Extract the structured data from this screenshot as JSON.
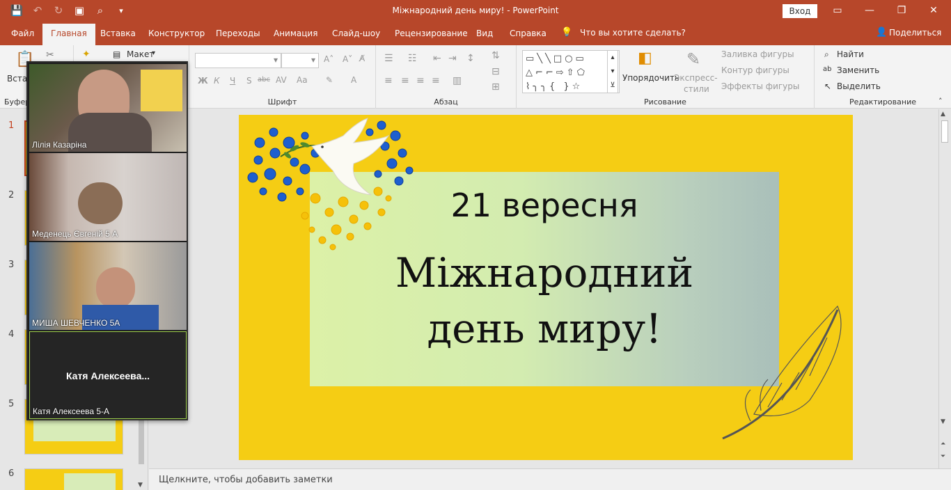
{
  "window": {
    "title": "Міжнародний день миру!  -  PowerPoint",
    "signin": "Вход"
  },
  "quick_access": [
    "save-icon",
    "undo-icon",
    "redo-icon",
    "present-icon",
    "print-preview-icon",
    "customize-icon"
  ],
  "menu": {
    "tabs": [
      "Файл",
      "Главная",
      "Вставка",
      "Конструктор",
      "Переходы",
      "Анимация",
      "Слайд-шоу",
      "Рецензирование",
      "Вид",
      "Справка"
    ],
    "active": "Главная",
    "tell_me": "Что вы хотите сделать?",
    "share": "Поделиться"
  },
  "ribbon": {
    "clipboard": {
      "paste": "Вста",
      "label": "Буфер"
    },
    "slides": {
      "layout": "Макет"
    },
    "font": {
      "label": "Шрифт",
      "bold": "Ж",
      "italic": "К",
      "underline": "Ч",
      "strike": "S",
      "strike2": "abc",
      "case": "Aa",
      "color": "A"
    },
    "paragraph": {
      "label": "Абзац"
    },
    "drawing": {
      "label": "Рисование",
      "arrange": "Упорядочить",
      "quick_styles_1": "Экспресс-",
      "quick_styles_2": "стили",
      "fill": "Заливка фигуры",
      "outline": "Контур фигуры",
      "effects": "Эффекты фигуры"
    },
    "editing": {
      "label": "Редактирование",
      "find": "Найти",
      "replace": "Заменить",
      "select": "Выделить"
    }
  },
  "thumbnails": [
    {
      "num": "1",
      "current": true
    },
    {
      "num": "2",
      "current": false
    },
    {
      "num": "3",
      "current": false
    },
    {
      "num": "4",
      "current": false
    },
    {
      "num": "5",
      "current": false
    },
    {
      "num": "6",
      "current": false
    }
  ],
  "slide": {
    "date": "21 вересня",
    "title_line1": "Міжнародний",
    "title_line2": "день миру!"
  },
  "notes_placeholder": "Щелкните, чтобы добавить заметки",
  "video_call": {
    "participants": [
      {
        "name": "Лілія Казаріна",
        "video": true
      },
      {
        "name": "Меденець Євгеній 5 А",
        "video": true
      },
      {
        "name": "МИША ШЕВЧЕНКО 5А",
        "video": true
      },
      {
        "name": "Катя Алексеева 5-А",
        "video": false,
        "display_name": "Катя  Алексеева..."
      }
    ]
  },
  "colors": {
    "accent": "#b7472a",
    "slide_bg": "#f5cd14",
    "active_tab_text": "#b7472a"
  }
}
